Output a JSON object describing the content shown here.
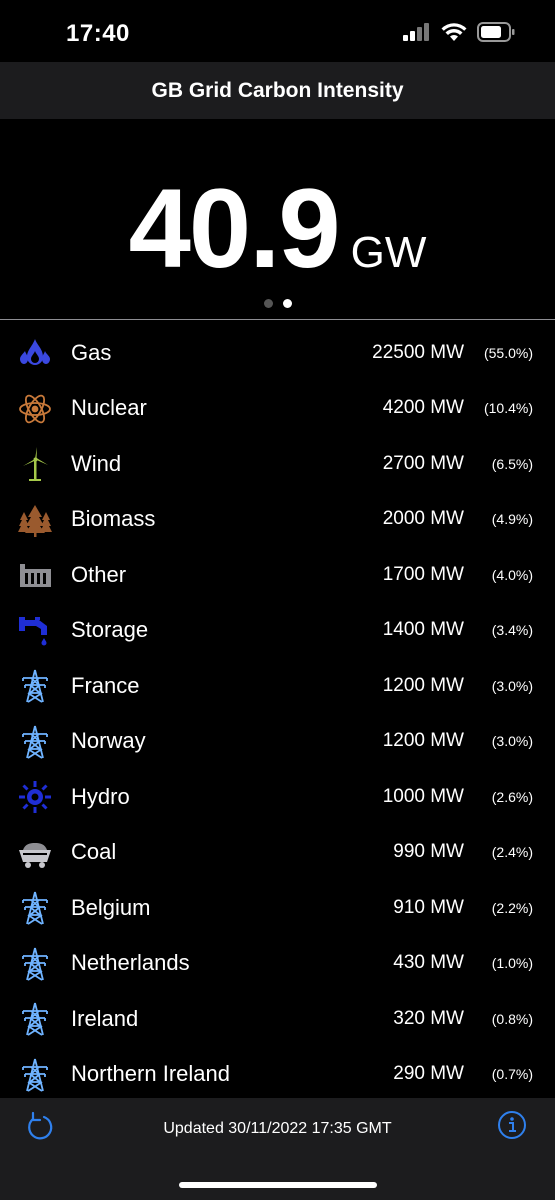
{
  "status_bar": {
    "time": "17:40",
    "icons": [
      "cellular-signal-icon",
      "wifi-icon",
      "battery-icon"
    ]
  },
  "nav": {
    "title": "GB Grid Carbon Intensity"
  },
  "hero": {
    "value": "40.9",
    "unit": "GW",
    "pages": 2,
    "active_page": 2
  },
  "colors": {
    "background": "#000000",
    "bar": "#1c1c1e",
    "accent_blue": "#2f80ed",
    "interconnector_blue": "#6fb3ff"
  },
  "sources": [
    {
      "name": "Gas",
      "mw": "22500 MW",
      "pct": "(55.0%)",
      "icon": "gas-flame-icon"
    },
    {
      "name": "Nuclear",
      "mw": "4200 MW",
      "pct": "(10.4%)",
      "icon": "atom-icon"
    },
    {
      "name": "Wind",
      "mw": "2700 MW",
      "pct": "(6.5%)",
      "icon": "wind-turbine-icon"
    },
    {
      "name": "Biomass",
      "mw": "2000 MW",
      "pct": "(4.9%)",
      "icon": "trees-icon"
    },
    {
      "name": "Other",
      "mw": "1700 MW",
      "pct": "(4.0%)",
      "icon": "factory-icon"
    },
    {
      "name": "Storage",
      "mw": "1400 MW",
      "pct": "(3.4%)",
      "icon": "water-tap-icon"
    },
    {
      "name": "France",
      "mw": "1200 MW",
      "pct": "(3.0%)",
      "icon": "pylon-icon"
    },
    {
      "name": "Norway",
      "mw": "1200 MW",
      "pct": "(3.0%)",
      "icon": "pylon-icon"
    },
    {
      "name": "Hydro",
      "mw": "1000 MW",
      "pct": "(2.6%)",
      "icon": "water-wheel-icon"
    },
    {
      "name": "Coal",
      "mw": "990 MW",
      "pct": "(2.4%)",
      "icon": "coal-cart-icon"
    },
    {
      "name": "Belgium",
      "mw": "910 MW",
      "pct": "(2.2%)",
      "icon": "pylon-icon"
    },
    {
      "name": "Netherlands",
      "mw": "430 MW",
      "pct": "(1.0%)",
      "icon": "pylon-icon"
    },
    {
      "name": "Ireland",
      "mw": "320 MW",
      "pct": "(0.8%)",
      "icon": "pylon-icon"
    },
    {
      "name": "Northern Ireland",
      "mw": "290 MW",
      "pct": "(0.7%)",
      "icon": "pylon-icon"
    }
  ],
  "toolbar": {
    "updated": "Updated 30/11/2022 17:35 GMT",
    "refresh_icon": "refresh-icon",
    "info_icon": "info-icon"
  }
}
